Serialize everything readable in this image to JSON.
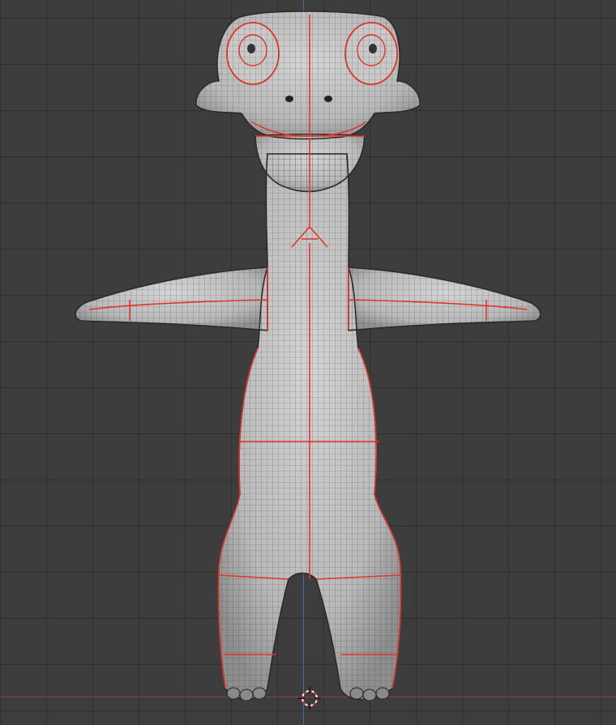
{
  "viewport": {
    "grid_visible": true,
    "axis_colors": {
      "x": "#9a3b3b",
      "y": "#3a6fb0"
    },
    "mesh_color": "#c8c8c8",
    "seam_color": "#e0352b",
    "wire_color": "#1e1e1e",
    "background": "#3d3d3d"
  },
  "icons": {
    "cursor": "3d-cursor-icon"
  }
}
